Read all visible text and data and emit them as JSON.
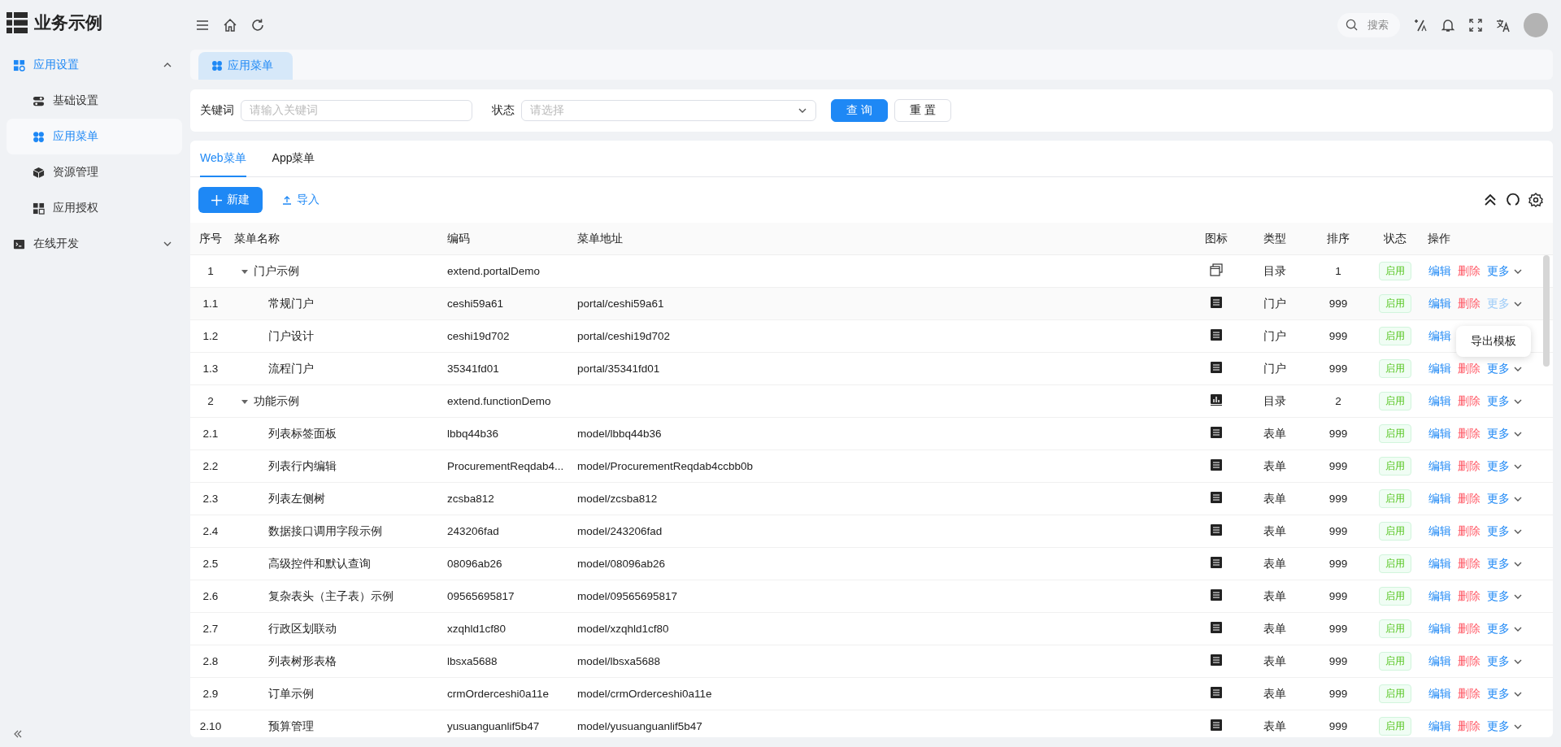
{
  "app": {
    "title": "业务示例"
  },
  "sidebar": {
    "items": [
      {
        "label": "应用设置",
        "expanded": true,
        "children": [
          {
            "label": "基础设置",
            "selected": false
          },
          {
            "label": "应用菜单",
            "selected": true
          },
          {
            "label": "资源管理",
            "selected": false
          },
          {
            "label": "应用授权",
            "selected": false
          }
        ]
      },
      {
        "label": "在线开发",
        "expanded": false
      }
    ]
  },
  "search": {
    "placeholder": "搜索"
  },
  "page_tabs": [
    {
      "label": "应用菜单",
      "selected": true
    }
  ],
  "filter": {
    "fields": [
      {
        "label": "关键词",
        "kind": "text",
        "placeholder": "请输入关键词"
      },
      {
        "label": "状态",
        "kind": "select",
        "placeholder": "请选择"
      }
    ],
    "buttons": [
      {
        "label": "查 询",
        "kind": "primary"
      },
      {
        "label": "重 置",
        "kind": "default"
      }
    ]
  },
  "menu_tabs": [
    {
      "label": "Web菜单",
      "selected": true
    },
    {
      "label": "App菜单",
      "selected": false
    }
  ],
  "toolbar": {
    "buttons": [
      {
        "label": "新建",
        "kind": "primary"
      },
      {
        "label": "导入",
        "kind": "link"
      }
    ]
  },
  "table": {
    "columns": [
      "序号",
      "菜单名称",
      "编码",
      "菜单地址",
      "图标",
      "类型",
      "排序",
      "状态",
      "操作"
    ],
    "rows": [
      {
        "index": "1",
        "name": "门户示例",
        "code": "extend.portalDemo",
        "kind": "window",
        "type": "目录",
        "order": "1",
        "status": "启用",
        "expanded": true,
        "menu_open": false,
        "actions": [
          {
            "label": "编辑",
            "kind": "edit"
          },
          {
            "label": "删除",
            "kind": "delete"
          },
          {
            "label": "更多",
            "kind": "more"
          }
        ],
        "children": [
          {
            "index": "1.1",
            "name": "常规门户",
            "code": "ceshi59a61",
            "address": "portal/ceshi59a61",
            "kind": "list",
            "type": "门户",
            "order": "999",
            "status": "启用",
            "menu_open": true,
            "actions": [
              {
                "label": "编辑",
                "kind": "edit"
              },
              {
                "label": "删除",
                "kind": "delete"
              },
              {
                "label": "更多",
                "kind": "more"
              }
            ]
          },
          {
            "index": "1.2",
            "name": "门户设计",
            "code": "ceshi19d702",
            "address": "portal/ceshi19d702",
            "kind": "list",
            "type": "门户",
            "order": "999",
            "status": "启用",
            "menu_open": false,
            "actions": [
              {
                "label": "编辑",
                "kind": "edit"
              }
            ]
          },
          {
            "index": "1.3",
            "name": "流程门户",
            "code": "35341fd01",
            "address": "portal/35341fd01",
            "kind": "list",
            "type": "门户",
            "order": "999",
            "status": "启用",
            "menu_open": false,
            "actions": [
              {
                "label": "编辑",
                "kind": "edit"
              },
              {
                "label": "删除",
                "kind": "delete"
              },
              {
                "label": "更多",
                "kind": "more"
              }
            ]
          }
        ]
      },
      {
        "index": "2",
        "name": "功能示例",
        "code": "extend.functionDemo",
        "kind": "chart",
        "type": "目录",
        "order": "2",
        "status": "启用",
        "expanded": true,
        "menu_open": false,
        "actions": [
          {
            "label": "编辑",
            "kind": "edit"
          },
          {
            "label": "删除",
            "kind": "delete"
          },
          {
            "label": "更多",
            "kind": "more"
          }
        ],
        "children": [
          {
            "index": "2.1",
            "name": "列表标签面板",
            "code": "lbbq44b36",
            "address": "model/lbbq44b36",
            "kind": "list",
            "type": "表单",
            "order": "999",
            "status": "启用",
            "menu_open": false,
            "actions": [
              {
                "label": "编辑",
                "kind": "edit"
              },
              {
                "label": "删除",
                "kind": "delete"
              },
              {
                "label": "更多",
                "kind": "more"
              }
            ]
          },
          {
            "index": "2.2",
            "name": "列表行内编辑",
            "code": "ProcurementReqdab4...",
            "address": "model/ProcurementReqdab4ccbb0b",
            "kind": "list",
            "type": "表单",
            "order": "999",
            "status": "启用",
            "menu_open": false,
            "actions": [
              {
                "label": "编辑",
                "kind": "edit"
              },
              {
                "label": "删除",
                "kind": "delete"
              },
              {
                "label": "更多",
                "kind": "more"
              }
            ]
          },
          {
            "index": "2.3",
            "name": "列表左侧树",
            "code": "zcsba812",
            "address": "model/zcsba812",
            "kind": "list",
            "type": "表单",
            "order": "999",
            "status": "启用",
            "menu_open": false,
            "actions": [
              {
                "label": "编辑",
                "kind": "edit"
              },
              {
                "label": "删除",
                "kind": "delete"
              },
              {
                "label": "更多",
                "kind": "more"
              }
            ]
          },
          {
            "index": "2.4",
            "name": "数据接口调用字段示例",
            "code": "243206fad",
            "address": "model/243206fad",
            "kind": "list",
            "type": "表单",
            "order": "999",
            "status": "启用",
            "menu_open": false,
            "actions": [
              {
                "label": "编辑",
                "kind": "edit"
              },
              {
                "label": "删除",
                "kind": "delete"
              },
              {
                "label": "更多",
                "kind": "more"
              }
            ]
          },
          {
            "index": "2.5",
            "name": "高级控件和默认查询",
            "code": "08096ab26",
            "address": "model/08096ab26",
            "kind": "list",
            "type": "表单",
            "order": "999",
            "status": "启用",
            "menu_open": false,
            "actions": [
              {
                "label": "编辑",
                "kind": "edit"
              },
              {
                "label": "删除",
                "kind": "delete"
              },
              {
                "label": "更多",
                "kind": "more"
              }
            ]
          },
          {
            "index": "2.6",
            "name": "复杂表头（主子表）示例",
            "code": "09565695817",
            "address": "model/09565695817",
            "kind": "list",
            "type": "表单",
            "order": "999",
            "status": "启用",
            "menu_open": false,
            "actions": [
              {
                "label": "编辑",
                "kind": "edit"
              },
              {
                "label": "删除",
                "kind": "delete"
              },
              {
                "label": "更多",
                "kind": "more"
              }
            ]
          },
          {
            "index": "2.7",
            "name": "行政区划联动",
            "code": "xzqhld1cf80",
            "address": "model/xzqhld1cf80",
            "kind": "list",
            "type": "表单",
            "order": "999",
            "status": "启用",
            "menu_open": false,
            "actions": [
              {
                "label": "编辑",
                "kind": "edit"
              },
              {
                "label": "删除",
                "kind": "delete"
              },
              {
                "label": "更多",
                "kind": "more"
              }
            ]
          },
          {
            "index": "2.8",
            "name": "列表树形表格",
            "code": "lbsxa5688",
            "address": "model/lbsxa5688",
            "kind": "list",
            "type": "表单",
            "order": "999",
            "status": "启用",
            "menu_open": false,
            "actions": [
              {
                "label": "编辑",
                "kind": "edit"
              },
              {
                "label": "删除",
                "kind": "delete"
              },
              {
                "label": "更多",
                "kind": "more"
              }
            ]
          },
          {
            "index": "2.9",
            "name": "订单示例",
            "code": "crmOrderceshi0a11e",
            "address": "model/crmOrderceshi0a11e",
            "kind": "list",
            "type": "表单",
            "order": "999",
            "status": "启用",
            "menu_open": false,
            "actions": [
              {
                "label": "编辑",
                "kind": "edit"
              },
              {
                "label": "删除",
                "kind": "delete"
              },
              {
                "label": "更多",
                "kind": "more"
              }
            ]
          },
          {
            "index": "2.10",
            "name": "预算管理",
            "code": "yusuanguanlif5b47",
            "address": "model/yusuanguanlif5b47",
            "kind": "list",
            "type": "表单",
            "order": "999",
            "status": "启用",
            "menu_open": false,
            "actions": [
              {
                "label": "编辑",
                "kind": "edit"
              },
              {
                "label": "删除",
                "kind": "delete"
              },
              {
                "label": "更多",
                "kind": "more"
              }
            ]
          }
        ]
      }
    ]
  },
  "row_menu": {
    "items": [
      "导出模板"
    ]
  }
}
